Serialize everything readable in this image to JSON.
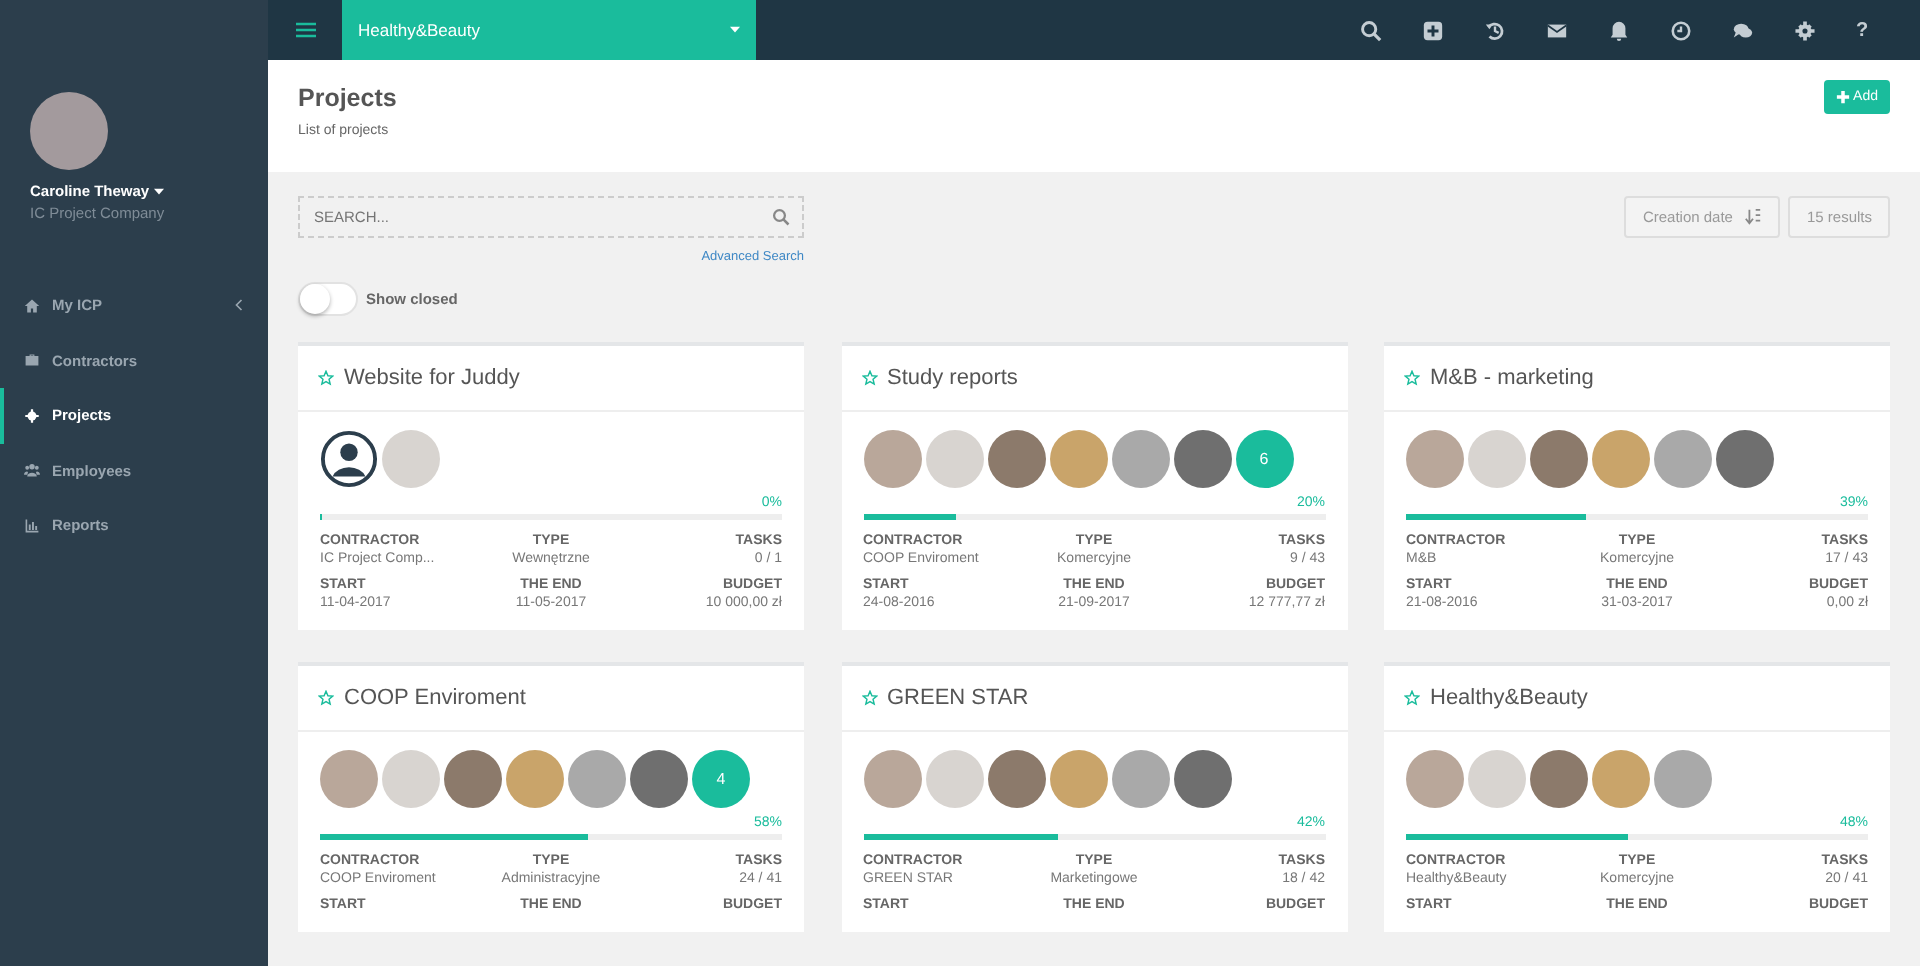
{
  "sidebar": {
    "user": {
      "name": "Caroline Theway",
      "company": "IC Project Company"
    },
    "items": [
      {
        "label": "My ICP",
        "selected": false,
        "has_submenu": true
      },
      {
        "label": "Contractors",
        "selected": false,
        "has_submenu": false
      },
      {
        "label": "Projects",
        "selected": true,
        "has_submenu": false
      },
      {
        "label": "Employees",
        "selected": false,
        "has_submenu": false
      },
      {
        "label": "Reports",
        "selected": false,
        "has_submenu": false
      }
    ]
  },
  "topbar": {
    "project_selector": "Healthy&Beauty",
    "help_label": "?"
  },
  "header": {
    "title": "Projects",
    "subtitle": "List of projects",
    "add_button": "Add"
  },
  "filters": {
    "search": {
      "placeholder": "SEARCH..."
    },
    "advanced_search": "Advanced Search",
    "show_closed": {
      "label": "Show closed",
      "on": false
    },
    "sort_button": "Creation date",
    "results": "15 results"
  },
  "projects": [
    {
      "title": "Website for Juddy",
      "members": [
        {
          "kind": "placeholder"
        },
        {
          "kind": "photo"
        }
      ],
      "progress": {
        "level": 0,
        "label": "0%"
      },
      "fields": [
        {
          "label": "CONTRACTOR",
          "value": "IC Project Comp..."
        },
        {
          "label": "TYPE",
          "value": "Wewnętrzne"
        },
        {
          "label": "TASKS",
          "value": "0 / 1"
        },
        {
          "label": "START",
          "value": "11-04-2017"
        },
        {
          "label": "THE END",
          "value": "11-05-2017"
        },
        {
          "label": "BUDGET",
          "value": "10 000,00 zł"
        }
      ]
    },
    {
      "title": "Study reports",
      "members": [
        {
          "kind": "photo"
        },
        {
          "kind": "photo"
        },
        {
          "kind": "photo"
        },
        {
          "kind": "photo"
        },
        {
          "kind": "photo"
        },
        {
          "kind": "photo"
        },
        {
          "kind": "more",
          "count": "6"
        }
      ],
      "progress": {
        "level": 0.2,
        "label": "20%"
      },
      "fields": [
        {
          "label": "CONTRACTOR",
          "value": "COOP Enviroment"
        },
        {
          "label": "TYPE",
          "value": "Komercyjne"
        },
        {
          "label": "TASKS",
          "value": "9 / 43"
        },
        {
          "label": "START",
          "value": "24-08-2016"
        },
        {
          "label": "THE END",
          "value": "21-09-2017"
        },
        {
          "label": "BUDGET",
          "value": "12 777,77 zł"
        }
      ]
    },
    {
      "title": "M&B - marketing",
      "members": [
        {
          "kind": "photo"
        },
        {
          "kind": "photo"
        },
        {
          "kind": "photo"
        },
        {
          "kind": "photo"
        },
        {
          "kind": "photo"
        },
        {
          "kind": "photo"
        }
      ],
      "progress": {
        "level": 0.39,
        "label": "39%"
      },
      "fields": [
        {
          "label": "CONTRACTOR",
          "value": "M&B"
        },
        {
          "label": "TYPE",
          "value": "Komercyjne"
        },
        {
          "label": "TASKS",
          "value": "17 / 43"
        },
        {
          "label": "START",
          "value": "21-08-2016"
        },
        {
          "label": "THE END",
          "value": "31-03-2017"
        },
        {
          "label": "BUDGET",
          "value": "0,00 zł"
        }
      ]
    },
    {
      "title": "COOP Enviroment",
      "members": [
        {
          "kind": "photo"
        },
        {
          "kind": "photo"
        },
        {
          "kind": "photo"
        },
        {
          "kind": "photo"
        },
        {
          "kind": "photo"
        },
        {
          "kind": "photo"
        },
        {
          "kind": "more",
          "count": "4"
        }
      ],
      "progress": {
        "level": 0.58,
        "label": "58%"
      },
      "fields": [
        {
          "label": "CONTRACTOR",
          "value": "COOP Enviroment"
        },
        {
          "label": "TYPE",
          "value": "Administracyjne"
        },
        {
          "label": "TASKS",
          "value": "24 / 41"
        },
        {
          "label": "START"
        },
        {
          "label": "THE END"
        },
        {
          "label": "BUDGET"
        }
      ]
    },
    {
      "title": "GREEN STAR",
      "members": [
        {
          "kind": "photo"
        },
        {
          "kind": "photo"
        },
        {
          "kind": "photo"
        },
        {
          "kind": "photo"
        },
        {
          "kind": "photo"
        },
        {
          "kind": "photo"
        }
      ],
      "progress": {
        "level": 0.42,
        "label": "42%"
      },
      "fields": [
        {
          "label": "CONTRACTOR",
          "value": "GREEN STAR"
        },
        {
          "label": "TYPE",
          "value": "Marketingowe"
        },
        {
          "label": "TASKS",
          "value": "18 / 42"
        },
        {
          "label": "START"
        },
        {
          "label": "THE END"
        },
        {
          "label": "BUDGET"
        }
      ]
    },
    {
      "title": "Healthy&Beauty",
      "members": [
        {
          "kind": "photo"
        },
        {
          "kind": "photo"
        },
        {
          "kind": "photo"
        },
        {
          "kind": "photo"
        },
        {
          "kind": "photo"
        }
      ],
      "progress": {
        "level": 0.48,
        "label": "48%"
      },
      "fields": [
        {
          "label": "CONTRACTOR",
          "value": "Healthy&Beauty"
        },
        {
          "label": "TYPE",
          "value": "Komercyjne"
        },
        {
          "label": "TASKS",
          "value": "20 / 41"
        },
        {
          "label": "START"
        },
        {
          "label": "THE END"
        },
        {
          "label": "BUDGET"
        }
      ]
    }
  ]
}
